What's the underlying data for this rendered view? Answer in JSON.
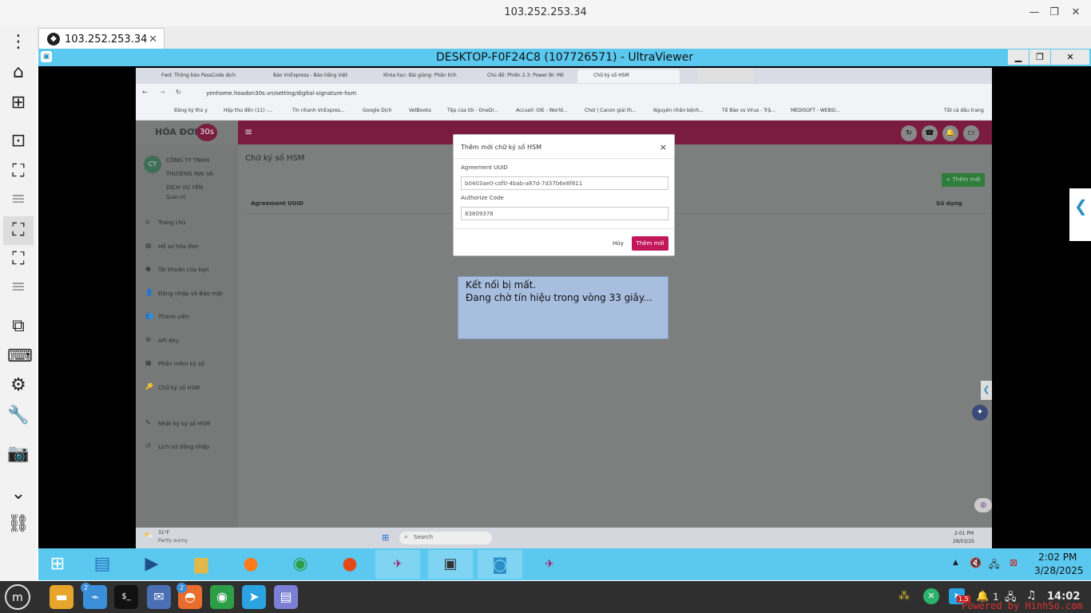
{
  "outer_window": {
    "title": "103.252.253.34",
    "min": "—",
    "max": "❐",
    "close": "✕"
  },
  "left_toolbar": {
    "menu": "⋮",
    "home": "⌂",
    "new_tab": "⊞",
    "fit": "⊡",
    "fullscreen": "⛶",
    "lines1": "≡",
    "scale": "⛶",
    "expand": "⛶",
    "lines2": "≡",
    "pip": "⧉",
    "keyboard": "⌨",
    "settings": "⚙",
    "tools": "🔧",
    "camera": "📷",
    "chevron": "⌄",
    "link": "⛓"
  },
  "tab": {
    "label": "103.252.253.34",
    "close": "✕"
  },
  "ultraviewer": {
    "title": "DESKTOP-F0F24C8 (107726571) - UltraViewer",
    "min": "▁",
    "max": "❐",
    "close": "✕"
  },
  "remote_browser": {
    "tabs": [
      "Fwd: Thông báo PassCode dịch",
      "Báo VnExpress - Báo tiếng Việt",
      "Khóa học: Bài giảng: Phân tích",
      "Chủ đề: Phiên 2.3: Power BI: Mô",
      "Chữ ký số HSM"
    ],
    "url": "yenhome.hoadon30s.vn/setting/digital-signature-hsm",
    "bookmarks": [
      "Đăng ký thủ y",
      "Hộp thư đến (11) -...",
      "Tin nhanh VnExpres...",
      "Google Dịch",
      "VetBooks",
      "Tệp của tôi - OneDr...",
      "Accueil: OIE - World...",
      "Chơi | Canon giải th...",
      "Nguyên nhân bệnh...",
      "Tế Bào vs Virus - Trậ...",
      "MEDISOFT - WEBSI...",
      "Tất cả dấu trang"
    ]
  },
  "remote_page": {
    "logo_text": "HÓA ĐƠN",
    "logo_badge": "30s",
    "company_initials": "CY",
    "company_name_lines": [
      "CÔNG TY TNHH",
      "THƯƠNG MẠI VÀ",
      "DỊCH VỤ YẾN"
    ],
    "role": "Quản trị",
    "menu": [
      {
        "icon": "⌂",
        "label": "Trang chủ"
      },
      {
        "icon": "▤",
        "label": "Hồ sơ hóa đơn"
      },
      {
        "icon": "◉",
        "label": "Tài khoản của bạn"
      },
      {
        "icon": "👤",
        "label": "Đăng nhập và Bảo mật"
      },
      {
        "icon": "👥",
        "label": "Thành viên"
      },
      {
        "icon": "⚙",
        "label": "API Key"
      },
      {
        "icon": "▦",
        "label": "Phần mềm ký số"
      },
      {
        "icon": "🔑",
        "label": "Chữ ký số HSM"
      },
      {
        "icon": "✎",
        "label": "Nhật ký ký số HSM"
      },
      {
        "icon": "↺",
        "label": "Lịch sử đăng nhập"
      }
    ],
    "page_title": "Chữ ký số HSM",
    "add_button": "+ Thêm mới",
    "table_headers": [
      "Agreement UUID",
      "Sử dụng"
    ],
    "avatar": "CY"
  },
  "modal": {
    "title": "Thêm mới chữ ký số HSM",
    "close": "×",
    "field1_label": "Agreement UUID",
    "field1_value": "b0403ae0-cdf0-4bab-a87d-7d37b6e8f811",
    "field2_label": "Authorize Code",
    "field2_value": "83809378",
    "cancel": "Hủy",
    "submit": "Thêm mới"
  },
  "connection_lost": {
    "line1": "Kết nối bị mất.",
    "line2": "Đang chờ tín hiệu trong vòng 33 giây..."
  },
  "remote_taskbar": {
    "weather_temp": "31°F",
    "weather_desc": "Partly sunny",
    "search": "Search",
    "time": "2:01 PM",
    "date": "28/03/25"
  },
  "uv_taskbar": {
    "time": "2:02 PM",
    "date": "3/28/2025"
  },
  "linux_taskbar": {
    "badge1": "2",
    "badge2": "2",
    "notif_count": "1",
    "volume_badge": "1.5",
    "time": "14:02",
    "watermark": "Powered by HinhSo.com"
  },
  "colors": {
    "uv_blue": "#5bc9ef",
    "brand_maroon": "#7a1c3e",
    "submit_pink": "#c2185b",
    "lost_box": "#a7bedf"
  }
}
